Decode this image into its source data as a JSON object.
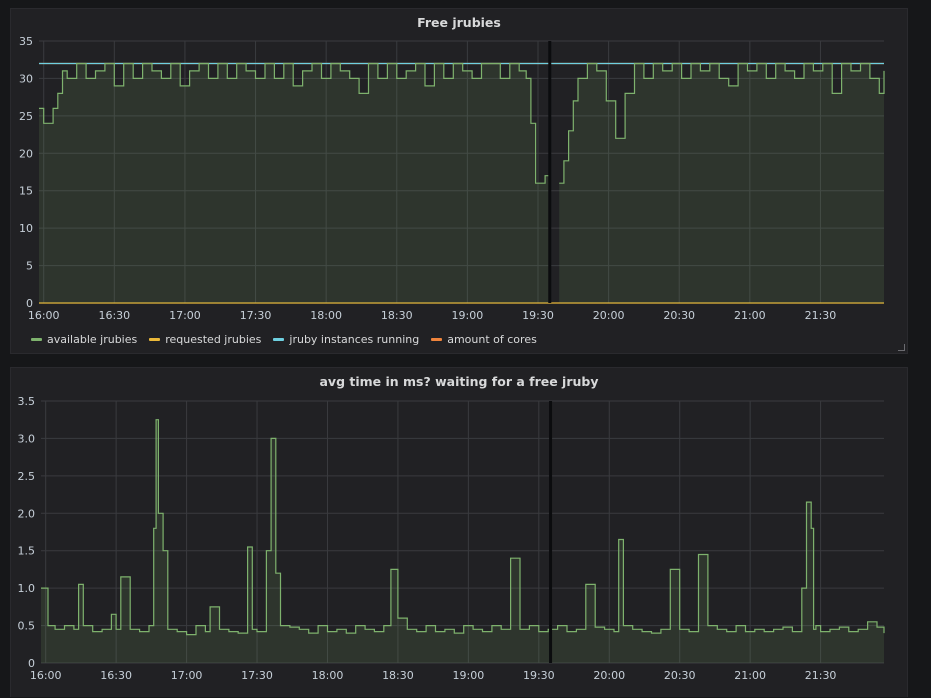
{
  "panels": [
    {
      "title": "Free jrubies",
      "legend": [
        {
          "name": "available jrubies",
          "color": "#7eb26d"
        },
        {
          "name": "requested jrubies",
          "color": "#eab839"
        },
        {
          "name": "jruby instances running",
          "color": "#6ed0e0"
        },
        {
          "name": "amount of cores",
          "color": "#ef843c"
        }
      ]
    },
    {
      "title": "avg time in ms? waiting for a free jruby"
    }
  ],
  "chart_data": [
    {
      "type": "line",
      "title": "Free jrubies",
      "x_ticks": [
        "16:00",
        "16:30",
        "17:00",
        "17:30",
        "18:00",
        "18:30",
        "19:00",
        "19:30",
        "20:00",
        "20:30",
        "21:00",
        "21:30"
      ],
      "x_range": [
        "15:58",
        "21:57"
      ],
      "ylim": [
        0,
        35
      ],
      "y_ticks": [
        0,
        5,
        10,
        15,
        20,
        25,
        30,
        35
      ],
      "grid": true,
      "legend_placement": "bottom-left",
      "marker_time": "19:35",
      "series": [
        {
          "name": "available jrubies",
          "color": "#7eb26d",
          "fill": true,
          "x": [
            "15:58",
            "16:00",
            "16:04",
            "16:06",
            "16:08",
            "16:10",
            "16:14",
            "16:18",
            "16:22",
            "16:26",
            "16:30",
            "16:34",
            "16:38",
            "16:42",
            "16:46",
            "16:50",
            "16:54",
            "16:58",
            "17:02",
            "17:06",
            "17:10",
            "17:14",
            "17:18",
            "17:22",
            "17:26",
            "17:30",
            "17:34",
            "17:38",
            "17:42",
            "17:46",
            "17:50",
            "17:54",
            "17:58",
            "18:02",
            "18:06",
            "18:10",
            "18:14",
            "18:18",
            "18:22",
            "18:26",
            "18:30",
            "18:34",
            "18:38",
            "18:42",
            "18:46",
            "18:50",
            "18:54",
            "18:58",
            "19:02",
            "19:06",
            "19:10",
            "19:14",
            "19:18",
            "19:22",
            "19:25",
            "19:27",
            "19:29",
            "19:31",
            "19:33",
            "19:35",
            "19:37",
            "19:39",
            "19:41",
            "19:43",
            "19:45",
            "19:47",
            "19:51",
            "19:55",
            "19:59",
            "20:03",
            "20:07",
            "20:11",
            "20:15",
            "20:19",
            "20:23",
            "20:27",
            "20:31",
            "20:35",
            "20:39",
            "20:43",
            "20:47",
            "20:51",
            "20:55",
            "20:59",
            "21:03",
            "21:07",
            "21:11",
            "21:15",
            "21:19",
            "21:23",
            "21:27",
            "21:31",
            "21:35",
            "21:39",
            "21:43",
            "21:47",
            "21:51",
            "21:55",
            "21:57"
          ],
          "values": [
            26,
            24,
            26,
            28,
            31,
            30,
            32,
            30,
            31,
            32,
            29,
            32,
            30,
            32,
            31,
            30,
            32,
            29,
            31,
            32,
            30,
            32,
            30,
            32,
            31,
            30,
            32,
            30,
            32,
            29,
            31,
            32,
            30,
            32,
            31,
            30,
            28,
            32,
            30,
            32,
            30,
            31,
            32,
            29,
            32,
            30,
            32,
            31,
            30,
            32,
            32,
            30,
            32,
            31,
            30,
            24,
            16,
            16,
            17,
            18,
            null,
            16,
            19,
            23,
            27,
            30,
            32,
            31,
            27,
            22,
            28,
            32,
            30,
            32,
            31,
            32,
            30,
            32,
            31,
            32,
            30,
            29,
            32,
            31,
            32,
            30,
            32,
            31,
            30,
            32,
            31,
            32,
            28,
            32,
            31,
            32,
            30,
            28,
            31
          ]
        },
        {
          "name": "requested jrubies",
          "color": "#eab839",
          "x": [
            "15:58",
            "21:57"
          ],
          "values": [
            0,
            0
          ]
        },
        {
          "name": "jruby instances running",
          "color": "#6ed0e0",
          "x": [
            "15:58",
            "21:57"
          ],
          "values": [
            32,
            32
          ]
        },
        {
          "name": "amount of cores",
          "color": "#ef843c",
          "x": [
            "15:58",
            "21:57"
          ],
          "values": [
            32,
            32
          ]
        }
      ]
    },
    {
      "type": "line",
      "title": "avg time in ms? waiting for a free jruby",
      "x_ticks": [
        "16:00",
        "16:30",
        "17:00",
        "17:30",
        "18:00",
        "18:30",
        "19:00",
        "19:30",
        "20:00",
        "20:30",
        "21:00",
        "21:30"
      ],
      "x_range": [
        "15:58",
        "21:57"
      ],
      "ylim": [
        0,
        3.5
      ],
      "y_ticks": [
        "0",
        "0.5",
        "1.0",
        "1.5",
        "2.0",
        "2.5",
        "3.0",
        "3.5"
      ],
      "grid": true,
      "marker_time": "19:35",
      "series": [
        {
          "color": "#7eb26d",
          "fill": true,
          "x": [
            "15:58",
            "16:01",
            "16:04",
            "16:08",
            "16:12",
            "16:14",
            "16:16",
            "16:20",
            "16:24",
            "16:28",
            "16:30",
            "16:32",
            "16:36",
            "16:40",
            "16:44",
            "16:46",
            "16:47",
            "16:48",
            "16:50",
            "16:52",
            "16:56",
            "17:00",
            "17:04",
            "17:08",
            "17:10",
            "17:14",
            "17:18",
            "17:22",
            "17:26",
            "17:28",
            "17:30",
            "17:34",
            "17:36",
            "17:38",
            "17:40",
            "17:44",
            "17:48",
            "17:52",
            "17:56",
            "18:00",
            "18:04",
            "18:08",
            "18:12",
            "18:16",
            "18:20",
            "18:24",
            "18:27",
            "18:30",
            "18:34",
            "18:38",
            "18:42",
            "18:46",
            "18:50",
            "18:54",
            "18:58",
            "19:02",
            "19:06",
            "19:10",
            "19:14",
            "19:18",
            "19:22",
            "19:26",
            "19:30",
            "19:34",
            "19:38",
            "19:42",
            "19:46",
            "19:50",
            "19:54",
            "19:58",
            "20:02",
            "20:04",
            "20:06",
            "20:10",
            "20:14",
            "20:18",
            "20:22",
            "20:26",
            "20:30",
            "20:34",
            "20:38",
            "20:42",
            "20:46",
            "20:50",
            "20:54",
            "20:58",
            "21:02",
            "21:06",
            "21:10",
            "21:14",
            "21:18",
            "21:22",
            "21:24",
            "21:26",
            "21:27",
            "21:28",
            "21:30",
            "21:34",
            "21:38",
            "21:42",
            "21:46",
            "21:50",
            "21:54",
            "21:57"
          ],
          "values": [
            1.0,
            0.5,
            0.45,
            0.5,
            0.45,
            1.05,
            0.5,
            0.42,
            0.45,
            0.65,
            0.45,
            1.15,
            0.45,
            0.42,
            0.5,
            1.8,
            3.25,
            2.0,
            1.5,
            0.45,
            0.42,
            0.38,
            0.5,
            0.42,
            0.75,
            0.45,
            0.42,
            0.4,
            1.55,
            0.45,
            0.42,
            1.5,
            3.0,
            1.2,
            0.5,
            0.48,
            0.45,
            0.4,
            0.5,
            0.42,
            0.45,
            0.4,
            0.5,
            0.45,
            0.42,
            0.5,
            1.25,
            0.6,
            0.45,
            0.42,
            0.5,
            0.42,
            0.45,
            0.4,
            0.5,
            0.45,
            0.42,
            0.5,
            0.45,
            1.4,
            0.45,
            0.5,
            0.42,
            0.45,
            0.5,
            0.42,
            0.45,
            1.05,
            0.48,
            0.45,
            0.42,
            1.65,
            0.5,
            0.45,
            0.42,
            0.4,
            0.45,
            1.25,
            0.45,
            0.42,
            1.45,
            0.5,
            0.45,
            0.42,
            0.5,
            0.42,
            0.45,
            0.42,
            0.45,
            0.48,
            0.42,
            1.0,
            2.15,
            1.8,
            0.45,
            0.5,
            0.42,
            0.45,
            0.48,
            0.42,
            0.45,
            0.55,
            0.48,
            0.4
          ]
        }
      ]
    }
  ]
}
